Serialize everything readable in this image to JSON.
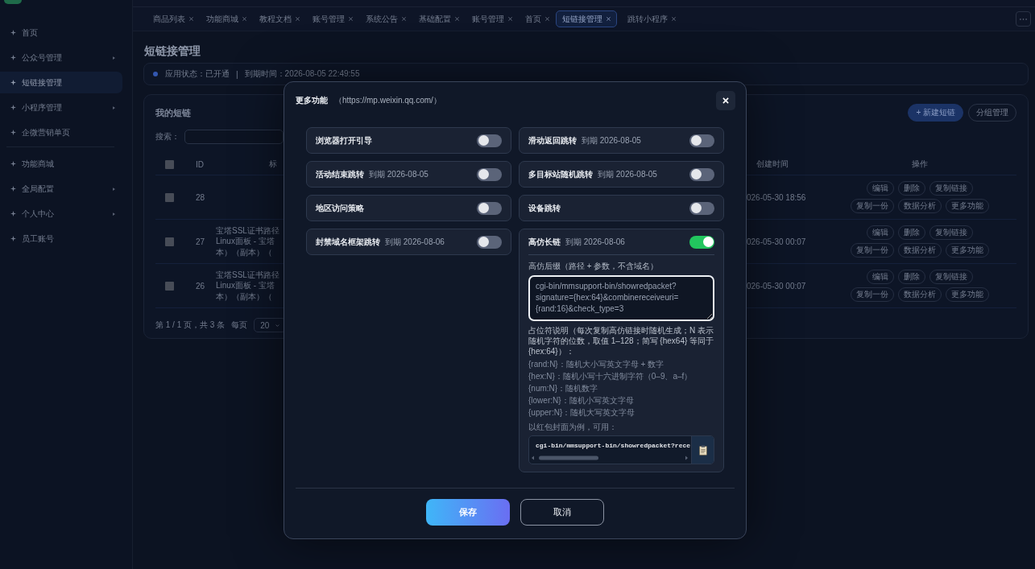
{
  "sidebar": {
    "groups": [
      {
        "items": [
          {
            "label": "首页",
            "selected": false,
            "expandable": false
          },
          {
            "label": "公众号管理",
            "selected": false,
            "expandable": true
          },
          {
            "label": "短链接管理",
            "selected": true,
            "expandable": false
          },
          {
            "label": "小程序管理",
            "selected": false,
            "expandable": true
          },
          {
            "label": "企微营销单页",
            "selected": false,
            "expandable": false
          }
        ]
      },
      {
        "items": [
          {
            "label": "功能商城",
            "selected": false,
            "expandable": false
          },
          {
            "label": "全局配置",
            "selected": false,
            "expandable": true
          },
          {
            "label": "个人中心",
            "selected": false,
            "expandable": true
          },
          {
            "label": "员工账号",
            "selected": false,
            "expandable": false
          }
        ]
      }
    ]
  },
  "tabs": [
    {
      "label": "商品列表",
      "selected": false
    },
    {
      "label": "功能商城",
      "selected": false
    },
    {
      "label": "教程文档",
      "selected": false
    },
    {
      "label": "账号管理",
      "selected": false
    },
    {
      "label": "系统公告",
      "selected": false
    },
    {
      "label": "基础配置",
      "selected": false
    },
    {
      "label": "账号管理",
      "selected": false
    },
    {
      "label": "首页",
      "selected": false
    },
    {
      "label": "短链接管理",
      "selected": true
    },
    {
      "label": "跳转小程序",
      "selected": false
    }
  ],
  "page": {
    "title": "短链接管理",
    "status": [
      "应用状态：已开通",
      "|",
      "到期时间：2026-08-05 22:49:55"
    ]
  },
  "card": {
    "title": "我的短链",
    "buttons": [
      {
        "label": "+ 新建短链",
        "kind": "primary"
      },
      {
        "label": "分组管理",
        "kind": "outline"
      }
    ],
    "search_label": "搜索：",
    "table": {
      "select_all_checked": false,
      "columns": [
        "ID",
        "标",
        "创建时间",
        "操作"
      ],
      "rows": [
        {
          "checked": false,
          "id": "28",
          "created": "026-05-30 18:56",
          "actions": [
            [
              "编辑",
              "删除",
              "复制链接"
            ],
            [
              "复制一份",
              "数据分析",
              "更多功能"
            ]
          ]
        },
        {
          "checked": false,
          "id": "27",
          "title_lines": [
            "宝塔SSL证书路径",
            "Linux面板 - 宝塔",
            "本）（副本）（"
          ],
          "created": "026-05-30 00:07",
          "actions": [
            [
              "编辑",
              "删除",
              "复制链接"
            ],
            [
              "复制一份",
              "数据分析",
              "更多功能"
            ]
          ]
        },
        {
          "checked": false,
          "id": "26",
          "title_lines": [
            "宝塔SSL证书路径",
            "Linux面板 - 宝塔",
            "本）（副本）（"
          ],
          "created": "026-05-30 00:07",
          "actions": [
            [
              "编辑",
              "删除",
              "复制链接"
            ],
            [
              "复制一份",
              "数据分析",
              "更多功能"
            ]
          ]
        }
      ]
    },
    "pagination": {
      "summary": "第 1 / 1 页，共 3 条",
      "per_page_label": "每页",
      "per_page": "20"
    }
  },
  "modal": {
    "title": "更多功能",
    "subtitle": "（https://mp.weixin.qq.com/）",
    "features": [
      {
        "name": "浏览器打开引导",
        "on": false
      },
      {
        "name": "滑动返回跳转",
        "expiry": "到期 2026-08-05",
        "on": false
      },
      {
        "name": "活动结束跳转",
        "expiry": "到期 2026-08-05",
        "on": false
      },
      {
        "name": "多目标站随机跳转",
        "expiry": "到期 2026-08-05",
        "on": false
      },
      {
        "name": "地区访问策略",
        "on": false
      },
      {
        "name": "设备跳转",
        "on": false
      },
      {
        "name": "封禁域名框架跳转",
        "expiry": "到期 2026-08-06",
        "on": false
      },
      {
        "name": "高仿长链",
        "expiry": "到期 2026-08-06",
        "on": true,
        "settings": {
          "field_label": "高仿后缀（路径 + 参数，不含域名）",
          "placeholder": "cgi-bin/mmsupport-bin/showredpacket?signature={hex:64}&combinereceiveuri={rand:16}&check_type=3",
          "focused": true,
          "help": "占位符说明（每次复制高仿链接时随机生成；N 表示随机字符的位数，取值 1–128；简写 {hex64} 等同于 {hex:64}）：",
          "placeholders": [
            "{rand:N}：随机大小写英文字母 + 数字",
            "{hex:N}：随机小写十六进制字符（0–9、a–f）",
            "{num:N}：随机数字",
            "{lower:N}：随机小写英文字母",
            "{upper:N}：随机大写英文字母"
          ],
          "example_label": "以红包封面为例，可用：",
          "example": "cgi-bin/mmsupport-bin/showredpacket?rece"
        }
      }
    ],
    "buttons": [
      {
        "label": "保存",
        "kind": "primary"
      },
      {
        "label": "取消",
        "kind": "secondary"
      }
    ]
  }
}
